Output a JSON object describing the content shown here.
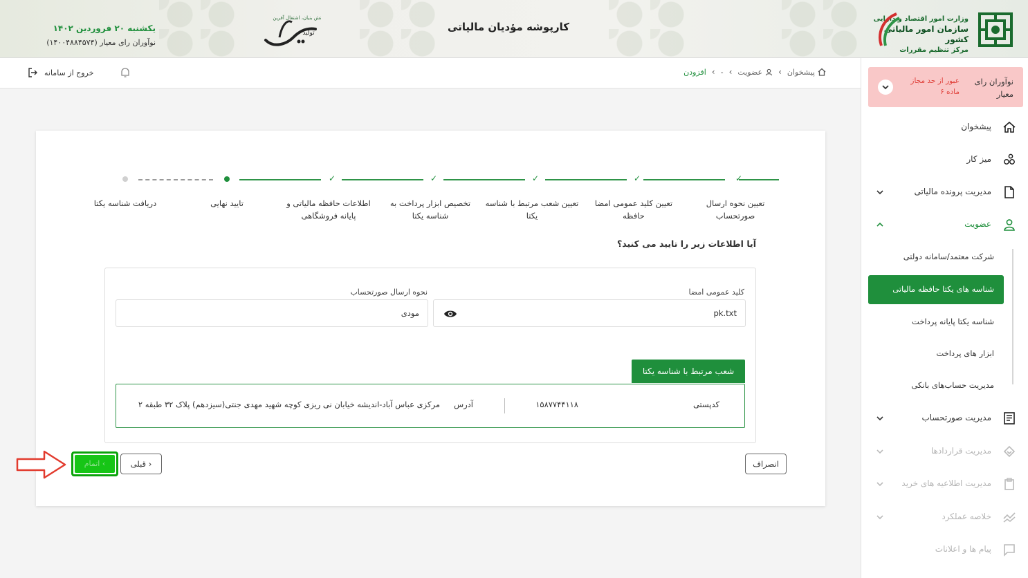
{
  "banner": {
    "title": "کارپوشه مؤدیان مالیاتی",
    "date": "یکشنبه ۲۰ فروردین ۱۴۰۲",
    "user": "نوآوران رای معیار (۱۴۰۰۴۸۸۴۵۷۴)",
    "org_line1": "وزارت امور اقتصاد و دارایی",
    "org_line2": "سازمان امور مالیاتی کشور",
    "org_line3": "مرکز تنظیم مقررات",
    "slogan_main": "تولید",
    "slogan_sub": "دانش بنیان، اشتغال آفرین"
  },
  "header": {
    "breadcrumb": [
      "پیشخوان",
      "عضویت",
      "-",
      "افزودن"
    ],
    "logout_label": "خروج از سامانه"
  },
  "stepper": {
    "steps": [
      {
        "label": "تعیین نحوه ارسال صورتحساب",
        "status": "done"
      },
      {
        "label": "تعیین کلید عمومی امضا حافظه",
        "status": "done"
      },
      {
        "label": "تعیین شعب مرتبط با شناسه یکتا",
        "status": "done"
      },
      {
        "label": "تخصیص ابزار پرداخت به شناسه یکتا",
        "status": "done"
      },
      {
        "label": "اطلاعات حافظه مالیاتی و پایانه فروشگاهی",
        "status": "done"
      },
      {
        "label": "تایید نهایی",
        "status": "current"
      },
      {
        "label": "دریافت شناسه یکتا",
        "status": "pending"
      }
    ]
  },
  "form": {
    "question": "آیا اطلاعات زیر را تایید می کنید؟",
    "public_key_label": "کلید عمومی امضا",
    "public_key_value": "pk.txt",
    "send_method_label": "نحوه ارسال صورتحساب",
    "send_method_value": "مودی",
    "branches_tab": "شعب مرتبط با شناسه یکتا",
    "branch": {
      "postal_label": "کدپستی",
      "postal_value": "۱۵۸۷۷۴۴۱۱۸",
      "address_label": "آدرس",
      "address_value": "مرکزی عباس آباد-اندیشه خیابان نی ریزی کوچه شهید مهدی جنتی(سیزدهم) پلاک ۳۲ طبقه ۲"
    }
  },
  "buttons": {
    "cancel": "انصراف",
    "prev": "قبلی",
    "finish": "اتمام"
  },
  "sidebar": {
    "user_name": "نوآوران رای معیار",
    "user_warning": "عبور از حد مجاز ماده ۶",
    "items": [
      {
        "label": "پیشخوان",
        "icon": "home-icon"
      },
      {
        "label": "میز کار",
        "icon": "workspace-icon"
      },
      {
        "label": "مدیریت پرونده مالیاتی",
        "icon": "file-icon"
      },
      {
        "label": "عضویت",
        "icon": "user-icon"
      },
      {
        "label": "مدیریت صورتحساب",
        "icon": "invoice-icon"
      },
      {
        "label": "مدیریت قراردادها",
        "icon": "contract-icon"
      },
      {
        "label": "مدیریت اطلاعیه های خرید",
        "icon": "purchase-icon"
      },
      {
        "label": "خلاصه عملکرد",
        "icon": "chart-icon"
      },
      {
        "label": "پیام ها و اعلانات",
        "icon": "message-icon"
      }
    ],
    "subitems": [
      {
        "label": "شرکت معتمد/سامانه دولتی"
      },
      {
        "label": "شناسه های یکتا حافظه مالیاتی"
      },
      {
        "label": "شناسه یکتا پایانه پرداخت"
      },
      {
        "label": "ابزار های پرداخت"
      },
      {
        "label": "مدیریت حساب‌های بانکی"
      }
    ]
  },
  "colors": {
    "primary_green": "#1f8f3c",
    "finish_green": "#16c516",
    "warning_bg": "#f9c8c8",
    "warning_text": "#e0403a",
    "arrow_red": "#e23b2e"
  }
}
